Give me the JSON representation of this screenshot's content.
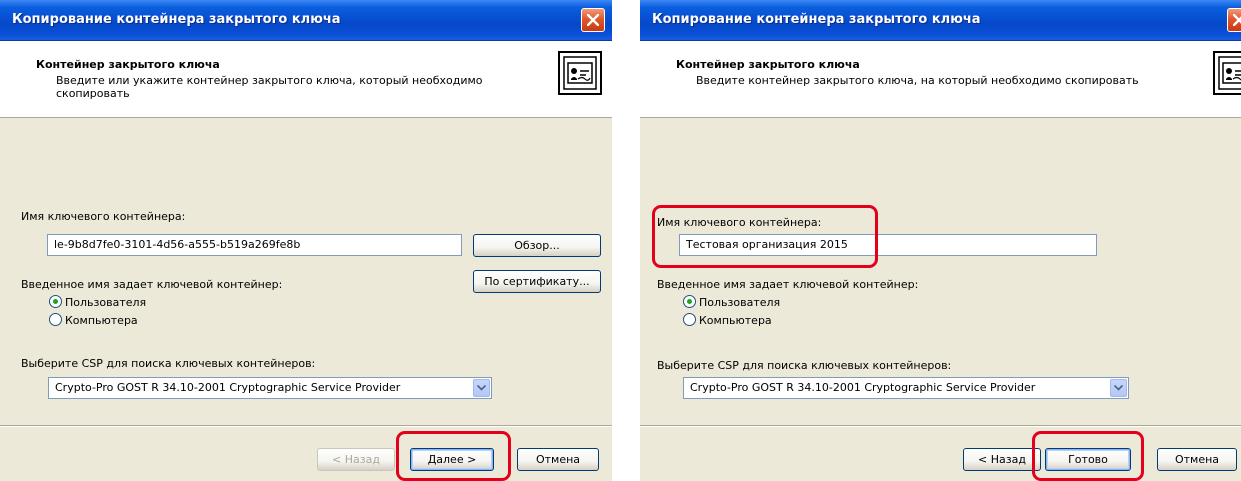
{
  "dialog1": {
    "title": "Копирование контейнера закрытого ключа",
    "header_title": "Контейнер закрытого ключа",
    "header_desc": "Введите или укажите контейнер закрытого ключа, который необходимо скопировать",
    "container_label": "Имя ключевого контейнера:",
    "container_value": "le-9b8d7fe0-3101-4d56-a555-b519a269fe8b",
    "browse_label": "Обзор...",
    "by_cert_label": "По сертификату...",
    "scope_label": "Введенное имя задает ключевой контейнер:",
    "radio_user": "Пользователя",
    "radio_computer": "Компьютера",
    "csp_label": "Выберите CSP для поиска ключевых контейнеров:",
    "csp_value": "Crypto-Pro GOST R 34.10-2001 Cryptographic Service Provider",
    "back_label": "< Назад",
    "next_label": "Далее >",
    "cancel_label": "Отмена"
  },
  "dialog2": {
    "title": "Копирование контейнера закрытого ключа",
    "header_title": "Контейнер закрытого ключа",
    "header_desc": "Введите контейнер закрытого ключа, на который необходимо скопировать",
    "container_label": "Имя ключевого контейнера:",
    "container_value": "Тестовая организация 2015",
    "scope_label": "Введенное имя задает ключевой контейнер:",
    "radio_user": "Пользователя",
    "radio_computer": "Компьютера",
    "csp_label": "Выберите CSP для поиска ключевых контейнеров:",
    "csp_value": "Crypto-Pro GOST R 34.10-2001 Cryptographic Service Provider",
    "back_label": "< Назад",
    "finish_label": "Готово",
    "cancel_label": "Отмена"
  },
  "colors": {
    "highlight": "#e3001b",
    "titlebar": "#0548c8",
    "dialog_bg": "#ece9d8"
  },
  "icons": [
    "close-icon",
    "key-container-icon",
    "dropdown-arrow-icon",
    "radio-icon"
  ]
}
